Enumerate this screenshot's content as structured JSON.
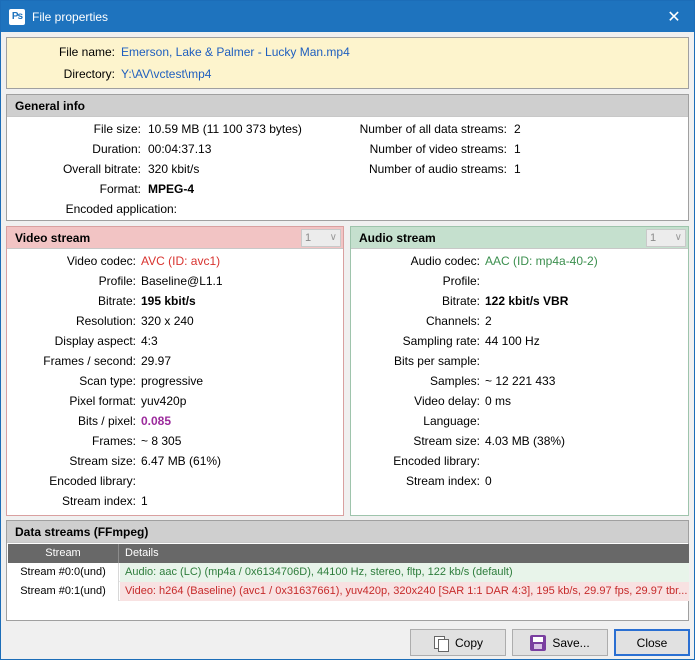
{
  "window": {
    "title": "File properties",
    "app_icon": "Ps",
    "close_glyph": "✕"
  },
  "file": {
    "name_label": "File name:",
    "name_value": "Emerson, Lake & Palmer - Lucky Man.mp4",
    "dir_label": "Directory:",
    "dir_value": "Y:\\AV\\vctest\\mp4"
  },
  "general": {
    "title": "General info",
    "left": [
      {
        "label": "File size:",
        "value": "10.59 MB (11 100 373 bytes)"
      },
      {
        "label": "Duration:",
        "value": "00:04:37.13"
      },
      {
        "label": "Overall bitrate:",
        "value": "320 kbit/s"
      },
      {
        "label": "Format:",
        "value": "MPEG-4"
      },
      {
        "label": "Encoded application:",
        "value": ""
      }
    ],
    "right": [
      {
        "label": "Number of all data streams:",
        "value": "2"
      },
      {
        "label": "Number of video streams:",
        "value": "1"
      },
      {
        "label": "Number of audio streams:",
        "value": "1"
      }
    ]
  },
  "video": {
    "title": "Video stream",
    "stream_select": "1",
    "rows": [
      {
        "label": "Video codec:",
        "value": "AVC (ID: avc1)"
      },
      {
        "label": "Profile:",
        "value": "Baseline@L1.1"
      },
      {
        "label": "Bitrate:",
        "value": "195 kbit/s"
      },
      {
        "label": "Resolution:",
        "value": "320 x 240"
      },
      {
        "label": "Display aspect:",
        "value": "4:3"
      },
      {
        "label": "Frames / second:",
        "value": "29.97"
      },
      {
        "label": "Scan type:",
        "value": "progressive"
      },
      {
        "label": "Pixel format:",
        "value": "yuv420p"
      },
      {
        "label": "Bits / pixel:",
        "value": "0.085"
      },
      {
        "label": "Frames:",
        "value": "~ 8 305"
      },
      {
        "label": "Stream size:",
        "value": "6.47 MB (61%)"
      },
      {
        "label": "Encoded library:",
        "value": ""
      },
      {
        "label": "Stream index:",
        "value": "1"
      }
    ]
  },
  "audio": {
    "title": "Audio stream",
    "stream_select": "1",
    "rows": [
      {
        "label": "Audio codec:",
        "value": "AAC (ID: mp4a-40-2)"
      },
      {
        "label": "Profile:",
        "value": ""
      },
      {
        "label": "Bitrate:",
        "value": "122 kbit/s  VBR"
      },
      {
        "label": "Channels:",
        "value": "2"
      },
      {
        "label": "Sampling rate:",
        "value": "44 100 Hz"
      },
      {
        "label": "Bits per sample:",
        "value": ""
      },
      {
        "label": "Samples:",
        "value": "~ 12 221 433"
      },
      {
        "label": "Video delay:",
        "value": "0 ms"
      },
      {
        "label": "Language:",
        "value": ""
      },
      {
        "label": "Stream size:",
        "value": "4.03 MB (38%)"
      },
      {
        "label": "Encoded library:",
        "value": ""
      },
      {
        "label": "Stream index:",
        "value": "0"
      }
    ]
  },
  "data_streams": {
    "title": "Data streams    (FFmpeg)",
    "columns": [
      "Stream",
      "Details"
    ],
    "rows": [
      {
        "stream": "Stream #0:0(und)",
        "details": "Audio: aac (LC) (mp4a / 0x6134706D), 44100 Hz, stereo, fltp, 122 kb/s (default)"
      },
      {
        "stream": "Stream #0:1(und)",
        "details": "Video: h264 (Baseline) (avc1 / 0x31637661), yuv420p, 320x240 [SAR 1:1 DAR 4:3], 195 kb/s, 29.97 fps, 29.97 tbr..."
      }
    ]
  },
  "buttons": {
    "copy": "Copy",
    "save": "Save...",
    "close": "Close"
  }
}
